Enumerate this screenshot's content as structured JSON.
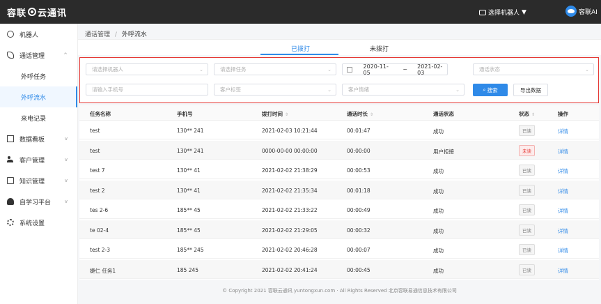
{
  "header": {
    "logo_text_left": "容联",
    "logo_text_right": "云通讯",
    "robot_select_label": "选择机器人",
    "user_name": "容联AI"
  },
  "sidebar": {
    "items": [
      {
        "label": "机器人",
        "icon": "robot-icon"
      },
      {
        "label": "通话管理",
        "icon": "phone-icon",
        "chevron": "^",
        "children": [
          {
            "label": "外呼任务"
          },
          {
            "label": "外呼流水"
          },
          {
            "label": "来电记录"
          }
        ]
      },
      {
        "label": "数据看板",
        "icon": "chart-icon",
        "chevron": "v"
      },
      {
        "label": "客户管理",
        "icon": "users-icon",
        "chevron": "v"
      },
      {
        "label": "知识管理",
        "icon": "book-icon",
        "chevron": "v"
      },
      {
        "label": "自学习平台",
        "icon": "person-icon",
        "chevron": "v"
      },
      {
        "label": "系统设置",
        "icon": "gear-icon"
      }
    ]
  },
  "breadcrumb": {
    "parent": "通话管理",
    "separator": "/",
    "current": "外呼流水"
  },
  "tabs": [
    {
      "label": "已拨打",
      "active": true
    },
    {
      "label": "未拨打",
      "active": false
    }
  ],
  "filters": {
    "robot_placeholder": "请选择机器人",
    "task_placeholder": "请选择任务",
    "date_start": "2020-11-05",
    "date_sep": "~",
    "date_end": "2021-02-03",
    "call_status_placeholder": "通话状态",
    "phone_placeholder": "请输入手机号",
    "customer_tag_placeholder": "客户标签",
    "customer_intent_placeholder": "客户情绪",
    "search_label": "搜索",
    "export_label": "导出数据"
  },
  "table": {
    "columns": [
      "任务名称",
      "手机号",
      "拨打时间",
      "通话时长",
      "通话状态",
      "状态",
      "操作"
    ],
    "rows": [
      {
        "task": "test",
        "phone": "130**  241",
        "time": "2021-02-03 10:21:44",
        "duration": "00:01:47",
        "call_status": "成功",
        "status": "已读",
        "status_red": false,
        "action": "详情"
      },
      {
        "task": "test",
        "phone": "130**  241",
        "time": "0000-00-00 00:00:00",
        "duration": "00:00:00",
        "call_status": "用户拒接",
        "status": "未读",
        "status_red": true,
        "action": "详情"
      },
      {
        "task": "test    7",
        "phone": "130**   41",
        "time": "2021-02-02 21:38:29",
        "duration": "00:00:53",
        "call_status": "成功",
        "status": "已读",
        "status_red": false,
        "action": "详情"
      },
      {
        "task": "test    2",
        "phone": "130**   41",
        "time": "2021-02-02 21:35:34",
        "duration": "00:01:18",
        "call_status": "成功",
        "status": "已读",
        "status_red": false,
        "action": "详情"
      },
      {
        "task": "tes    2-6",
        "phone": "185**   45",
        "time": "2021-02-02 21:33:22",
        "duration": "00:00:49",
        "call_status": "成功",
        "status": "已读",
        "status_red": false,
        "action": "详情"
      },
      {
        "task": "te    02-4",
        "phone": "185**   45",
        "time": "2021-02-02 21:29:05",
        "duration": "00:00:32",
        "call_status": "成功",
        "status": "已读",
        "status_red": false,
        "action": "详情"
      },
      {
        "task": "test    2-3",
        "phone": "185**   245",
        "time": "2021-02-02 20:46:28",
        "duration": "00:00:07",
        "call_status": "成功",
        "status": "已读",
        "status_red": false,
        "action": "详情"
      },
      {
        "task": "婕仁    任务1",
        "phone": "185    245",
        "time": "2021-02-02 20:41:24",
        "duration": "00:00:45",
        "call_status": "成功",
        "status": "已读",
        "status_red": false,
        "action": "详情"
      }
    ]
  },
  "footer": {
    "text": "© Copyright 2021   容联云通讯   yuntongxun.com · All Rights Reserved  北京容联易通信息技术有限公司"
  },
  "colors": {
    "accent": "#2f8ae8",
    "topbar": "#2b2b2b",
    "highlight_border": "#e53935"
  }
}
